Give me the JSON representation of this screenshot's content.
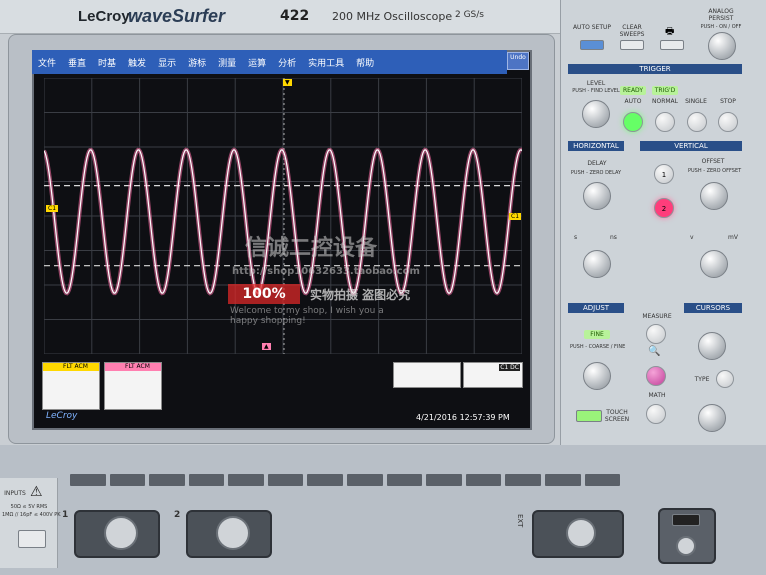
{
  "header": {
    "brand": "LeCroy",
    "series": "waveSurfer",
    "model": "422",
    "title": "200 MHz Oscilloscope",
    "sample_rate": "2 GS/s"
  },
  "menu": [
    "文件",
    "垂直",
    "时基",
    "触发",
    "显示",
    "游标",
    "测量",
    "运算",
    "分析",
    "实用工具",
    "帮助"
  ],
  "undo_label": "Undo",
  "screen": {
    "ch1_label": "C1",
    "trigger_ch": "C1",
    "timestamp": "4/21/2016 12:57:39 PM",
    "scope_logo": "LeCroy",
    "info_left_header": "FLT ACM",
    "info_mid_header": "FLT ACM",
    "info_right_tag": "C1 DC"
  },
  "waveform": {
    "cycles": 10,
    "color": "#ff6fa8",
    "trace_color": "#ffffff"
  },
  "panel": {
    "auto_setup": "AUTO SETUP",
    "clear_sweeps": "CLEAR SWEEPS",
    "analog_persist": "ANALOG PERSIST",
    "push_on_off": "PUSH - ON / OFF",
    "trigger": "TRIGGER",
    "level": "LEVEL",
    "push_find_level": "PUSH - FIND LEVEL",
    "ready": "READY",
    "trigd": "TRIG'D",
    "auto": "AUTO",
    "normal": "NORMAL",
    "single": "SINGLE",
    "stop": "STOP",
    "horizontal": "HORIZONTAL",
    "vertical": "VERTICAL",
    "delay": "DELAY",
    "push_zero_delay": "PUSH - ZERO DELAY",
    "offset": "OFFSET",
    "push_zero_offset": "PUSH - ZERO OFFSET",
    "ch1_btn": "1",
    "ch2_btn": "2",
    "s_unit": "s",
    "ns_unit": "ns",
    "v_unit": "v",
    "mv_unit": "mV",
    "adjust": "ADJUST",
    "cursors": "CURSORS",
    "fine": "FINE",
    "push_coarse_fine": "PUSH - COARSE / FINE",
    "measure": "MEASURE",
    "type": "TYPE",
    "math": "MATH",
    "touch_screen": "TOUCH SCREEN"
  },
  "inputs": {
    "label": "INPUTS",
    "rating1": "50Ω ≤ 5V RMS",
    "rating2": "1MΩ // 16pF ≤ 400V PK",
    "ch1": "1",
    "ch2": "2",
    "ext": "EXT"
  },
  "watermark": {
    "line1": "信诚二控设备",
    "line2": "http://shop10632633.taobao.com",
    "badge": "100%",
    "badge_text": "实物拍摄 盗图必究",
    "welcome1": "Welcome to my shop, I wish you a",
    "welcome2": "happy shopping!"
  }
}
